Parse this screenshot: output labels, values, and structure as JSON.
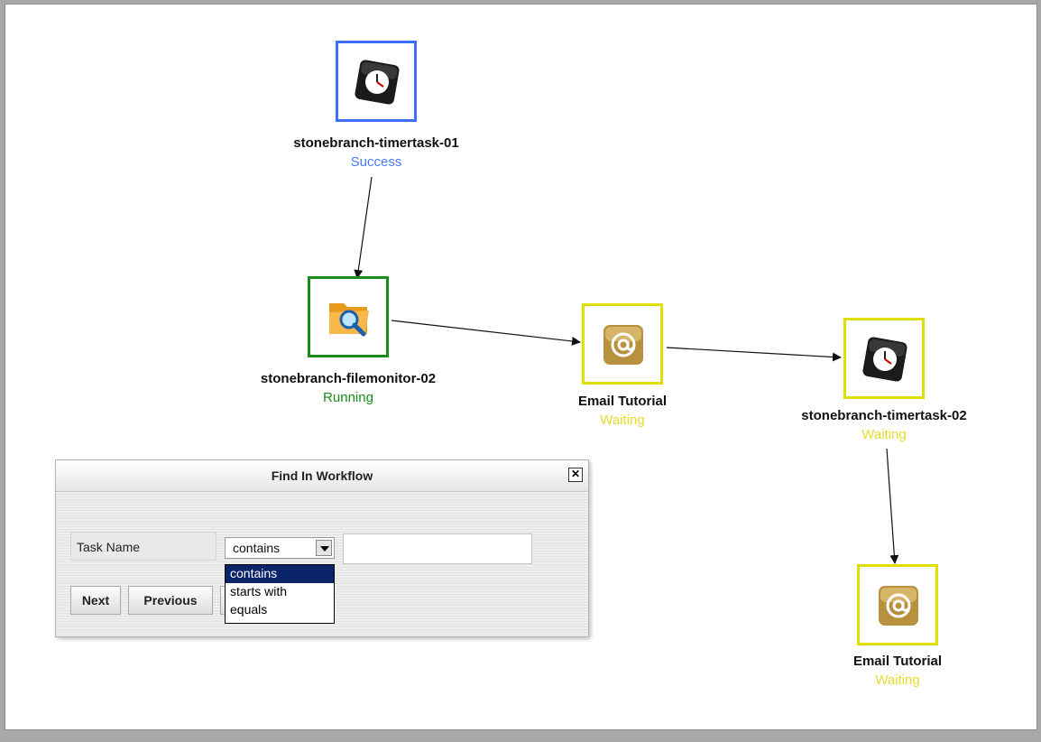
{
  "workflow": {
    "nodes": [
      {
        "id": "timertask-01",
        "name": "stonebranch-timertask-01",
        "status": "Success",
        "icon": "clock-icon",
        "border_color": "#3f6fff"
      },
      {
        "id": "filemonitor-02",
        "name": "stonebranch-filemonitor-02",
        "status": "Running",
        "icon": "folder-search-icon",
        "border_color": "#1a8c1a"
      },
      {
        "id": "email-1",
        "name": "Email Tutorial",
        "status": "Waiting",
        "icon": "email-at-icon",
        "border_color": "#e0e000"
      },
      {
        "id": "timertask-02",
        "name": "stonebranch-timertask-02",
        "status": "Waiting",
        "icon": "clock-icon",
        "border_color": "#e0e000"
      },
      {
        "id": "email-2",
        "name": "Email Tutorial",
        "status": "Waiting",
        "icon": "email-at-icon",
        "border_color": "#e0e000"
      }
    ],
    "edges": [
      {
        "from": "timertask-01",
        "to": "filemonitor-02"
      },
      {
        "from": "filemonitor-02",
        "to": "email-1"
      },
      {
        "from": "email-1",
        "to": "timertask-02"
      },
      {
        "from": "timertask-02",
        "to": "email-2"
      }
    ]
  },
  "find_dialog": {
    "title": "Find In Workflow",
    "field_label": "Task Name",
    "match_mode": "contains",
    "search_value": "",
    "match_options": [
      "contains",
      "starts with",
      "equals"
    ],
    "buttons": {
      "next": "Next",
      "previous": "Previous"
    }
  }
}
